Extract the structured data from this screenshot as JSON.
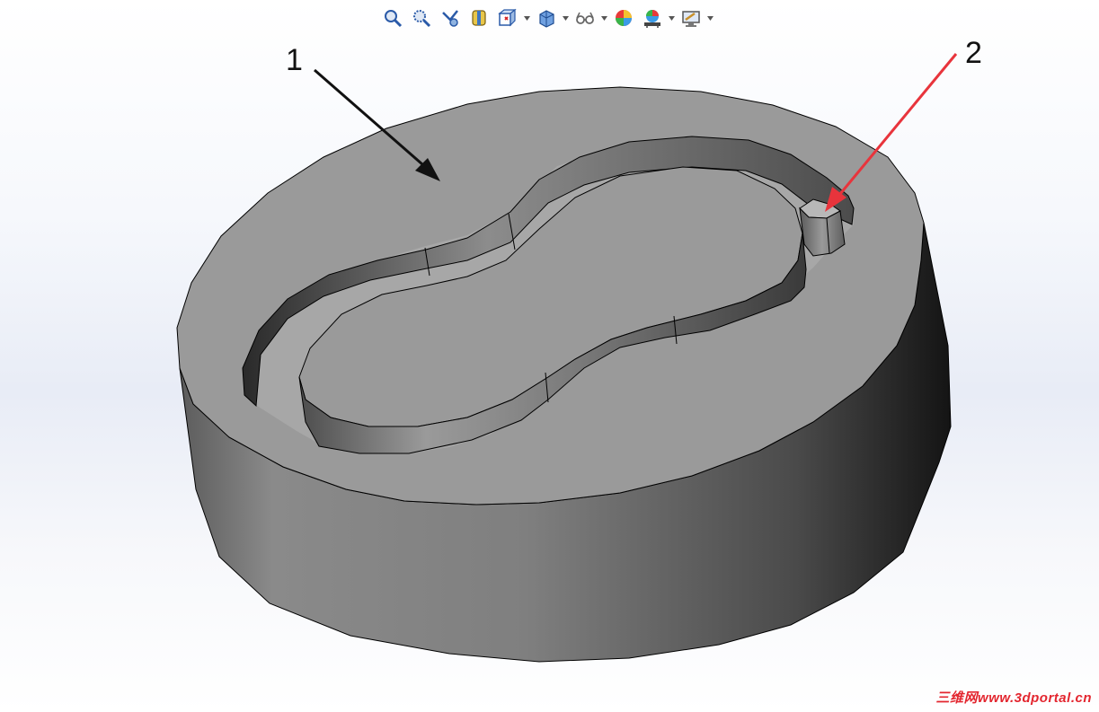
{
  "toolbar": {
    "buttons": [
      {
        "name": "zoom-to-fit",
        "icon": "zoom-to-fit-icon",
        "has_caret": false
      },
      {
        "name": "zoom-to-area",
        "icon": "zoom-to-area-icon",
        "has_caret": false
      },
      {
        "name": "previous-view",
        "icon": "previous-view-icon",
        "has_caret": false
      },
      {
        "name": "section-view",
        "icon": "section-view-icon",
        "has_caret": false
      },
      {
        "name": "view-orientation",
        "icon": "view-orientation-icon",
        "has_caret": true
      },
      {
        "name": "display-style",
        "icon": "display-style-icon",
        "has_caret": true
      },
      {
        "name": "hide-show-items",
        "icon": "hide-show-items-icon",
        "has_caret": true
      },
      {
        "name": "edit-appearance",
        "icon": "edit-appearance-icon",
        "has_caret": false
      },
      {
        "name": "apply-scene",
        "icon": "apply-scene-icon",
        "has_caret": true
      },
      {
        "name": "view-settings",
        "icon": "view-settings-icon",
        "has_caret": true
      }
    ]
  },
  "callouts": {
    "label_1": "1",
    "label_2": "2"
  },
  "watermark": {
    "text": "三维网www.3dportal.cn"
  },
  "colors": {
    "callout_1_arrow": "#111111",
    "callout_2_arrow": "#e8343c",
    "top_face": "#9a9a9a",
    "watermark": "#e3262f"
  }
}
